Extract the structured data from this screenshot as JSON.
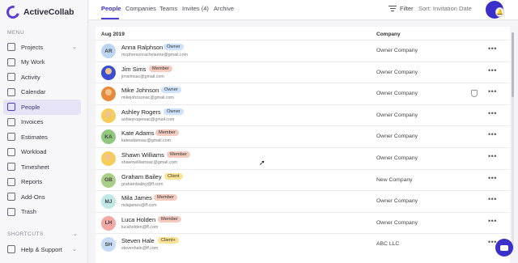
{
  "app": {
    "name": "ActiveCollab"
  },
  "sidebar": {
    "menu_label": "MENU",
    "items": [
      {
        "label": "Projects",
        "icon": "projects-icon",
        "chevron": "⌄"
      },
      {
        "label": "My Work",
        "icon": "my-work-icon"
      },
      {
        "label": "Activity",
        "icon": "activity-icon"
      },
      {
        "label": "Calendar",
        "icon": "calendar-icon"
      },
      {
        "label": "People",
        "icon": "people-icon",
        "active": true
      },
      {
        "label": "Invoices",
        "icon": "invoices-icon"
      },
      {
        "label": "Estimates",
        "icon": "estimates-icon"
      },
      {
        "label": "Workload",
        "icon": "workload-icon"
      },
      {
        "label": "Timesheet",
        "icon": "timesheet-icon"
      },
      {
        "label": "Reports",
        "icon": "reports-icon"
      },
      {
        "label": "Add-Ons",
        "icon": "add-ons-icon"
      },
      {
        "label": "Trash",
        "icon": "trash-icon"
      }
    ],
    "shortcuts_label": "SHORTCUTS",
    "help_label": "Help & Support"
  },
  "topbar": {
    "tabs": [
      "People",
      "Companies",
      "Teams",
      "Invites (4)",
      "Archive"
    ],
    "filter_label": "Filter",
    "sort_label": "Sort: Invitation Date"
  },
  "table": {
    "group_header": "Aug 2019",
    "company_header": "Company",
    "rows": [
      {
        "initials": "AR",
        "name": "Anna Ralphson",
        "role": "Owner",
        "email": "mcphersonrachelanne@gmail.com",
        "company": "Owner Company"
      },
      {
        "initials": "",
        "name": "Jim Sims",
        "role": "Member",
        "email": "jimsimsac@gmail.com",
        "company": "Owner Company"
      },
      {
        "initials": "",
        "name": "Mike Johnson",
        "role": "Owner",
        "email": "mikejohnsonac@gmail.com",
        "company": "Owner Company"
      },
      {
        "initials": "",
        "name": "Ashley Rogers",
        "role": "Owner",
        "email": "ashleyrogersac@gmail.com",
        "company": "Owner Company"
      },
      {
        "initials": "KA",
        "name": "Kate Adams",
        "role": "Member",
        "email": "kateadamsac@gmail.com",
        "company": "Owner Company"
      },
      {
        "initials": "",
        "name": "Shawn Williams",
        "role": "Member",
        "email": "shawnwilliamsac@gmail.com",
        "company": "Owner Company"
      },
      {
        "initials": "GB",
        "name": "Graham Bailey",
        "role": "Client",
        "email": "grahambailey@ff.com",
        "company": "New Company"
      },
      {
        "initials": "MJ",
        "name": "Mila James",
        "role": "Member",
        "email": "milajames@ff.com",
        "company": "Owner Company"
      },
      {
        "initials": "LH",
        "name": "Luca Holden",
        "role": "Member",
        "email": "lucaholden@ff.com",
        "company": "Owner Company"
      },
      {
        "initials": "SH",
        "name": "Steven Hale",
        "role": "Client+",
        "email": "stevenhale@ff.com",
        "company": "ABC LLC"
      }
    ]
  },
  "colors": {
    "accent": "#3d2fcc",
    "owner": "#cfe2fb",
    "member": "#f3cbbf",
    "client": "#fbe396"
  }
}
